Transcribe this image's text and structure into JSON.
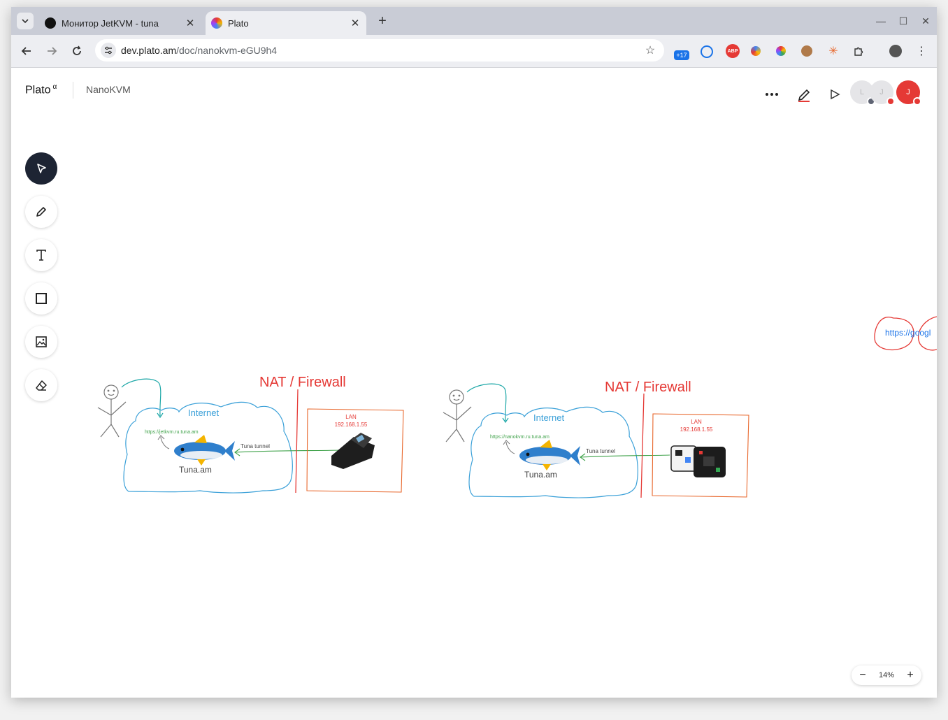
{
  "browser": {
    "tabs": [
      {
        "title": "Монитор JetKVM - tuna",
        "active": false
      },
      {
        "title": "Plato",
        "active": true
      }
    ],
    "url": {
      "host": "dev.plato.am",
      "path": "/doc/nanokvm-eGU9h4"
    },
    "extension_badge": "+17"
  },
  "app": {
    "brand": "Plato",
    "brand_sup": "α",
    "doc_title": "NanoKVM",
    "avatars": [
      {
        "letter": "L",
        "color": "#e5e5e8",
        "status": "#5f6473"
      },
      {
        "letter": "J",
        "color": "#e5e5e8",
        "status": "#e53935"
      },
      {
        "letter": "J",
        "color": "#e53935",
        "status": "#e53935"
      }
    ],
    "zoom": "14%"
  },
  "canvas": {
    "diagram1": {
      "firewall": "NAT / Firewall",
      "internet": "Internet",
      "url": "https://jetkvm.ru.tuna.am",
      "tunnel": "Tuna tunnel",
      "service": "Tuna.am",
      "lan": "LAN",
      "ip": "192.168.1.55"
    },
    "diagram2": {
      "firewall": "NAT / Firewall",
      "internet": "Internet",
      "url": "https://nanokvm.ru.tuna.am",
      "tunnel": "Tuna tunnel",
      "service": "Tuna.am",
      "lan": "LAN",
      "ip": "192.168.1.55"
    },
    "edge_text": "https://googl"
  },
  "colors": {
    "accent_red": "#e53935",
    "internet_blue": "#3aa0d8",
    "tunnel_green": "#3fa24a",
    "dark": "#1d2433"
  }
}
